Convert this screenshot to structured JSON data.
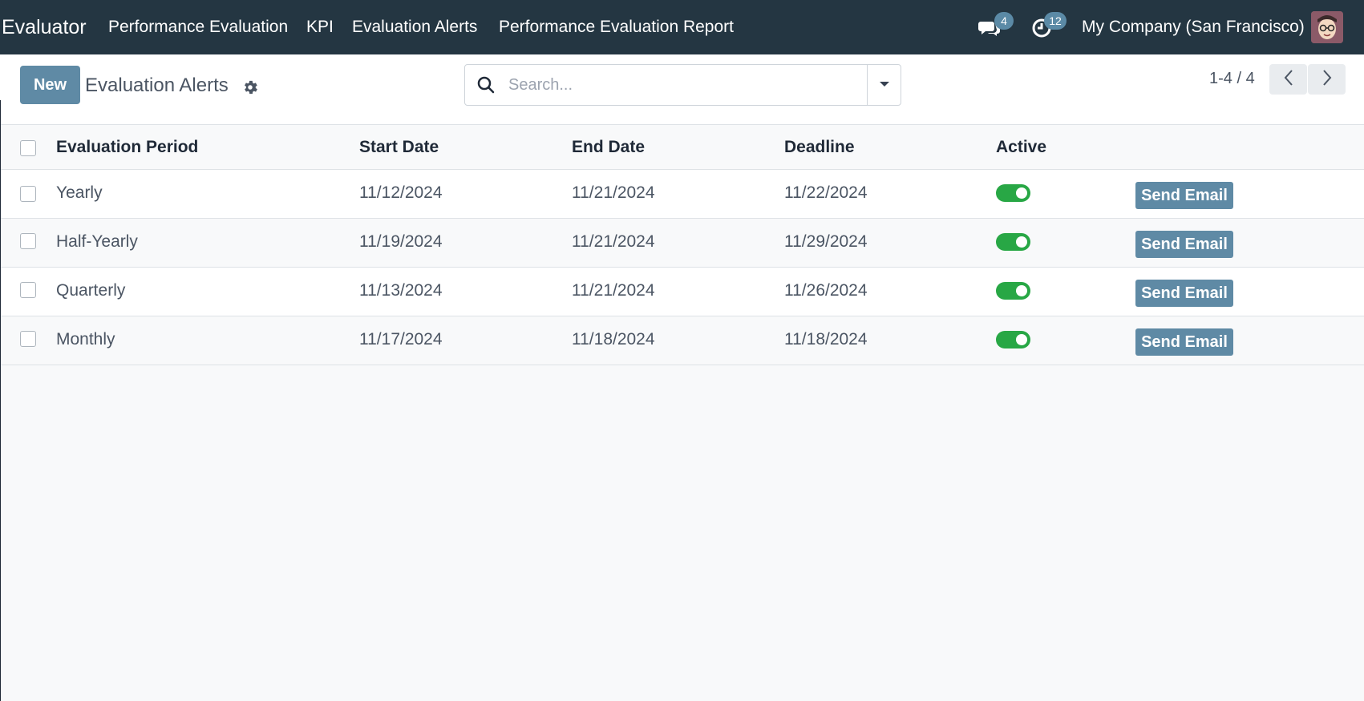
{
  "navbar": {
    "brand": "Evaluator",
    "menu": [
      {
        "label": "Performance Evaluation"
      },
      {
        "label": "KPI"
      },
      {
        "label": "Evaluation Alerts"
      },
      {
        "label": "Performance Evaluation Report"
      }
    ],
    "messages_icon": "chat-bubbles-icon",
    "messages_count": "4",
    "activities_icon": "clock-icon",
    "activities_count": "12",
    "company": "My Company (San Francisco)",
    "avatar_icon": "user-avatar-icon"
  },
  "control_panel": {
    "new_label": "New",
    "title": "Evaluation Alerts",
    "settings_icon": "gear-icon",
    "search": {
      "placeholder": "Search...",
      "value": ""
    },
    "pager": {
      "value": "1-4 / 4"
    }
  },
  "table": {
    "columns": [
      "Evaluation Period",
      "Start Date",
      "End Date",
      "Deadline",
      "Active"
    ],
    "rows": [
      {
        "period": "Yearly",
        "start": "11/12/2024",
        "end": "11/21/2024",
        "deadline": "11/22/2024",
        "active": true,
        "action": "Send Email"
      },
      {
        "period": "Half-Yearly",
        "start": "11/19/2024",
        "end": "11/21/2024",
        "deadline": "11/29/2024",
        "active": true,
        "action": "Send Email"
      },
      {
        "period": "Quarterly",
        "start": "11/13/2024",
        "end": "11/21/2024",
        "deadline": "11/26/2024",
        "active": true,
        "action": "Send Email"
      },
      {
        "period": "Monthly",
        "start": "11/17/2024",
        "end": "11/18/2024",
        "deadline": "11/18/2024",
        "active": true,
        "action": "Send Email"
      }
    ]
  },
  "colors": {
    "navbar_bg": "#243642",
    "primary": "#5f8aa5",
    "toggle_on": "#28a745",
    "badge": "#5b8aa6"
  }
}
